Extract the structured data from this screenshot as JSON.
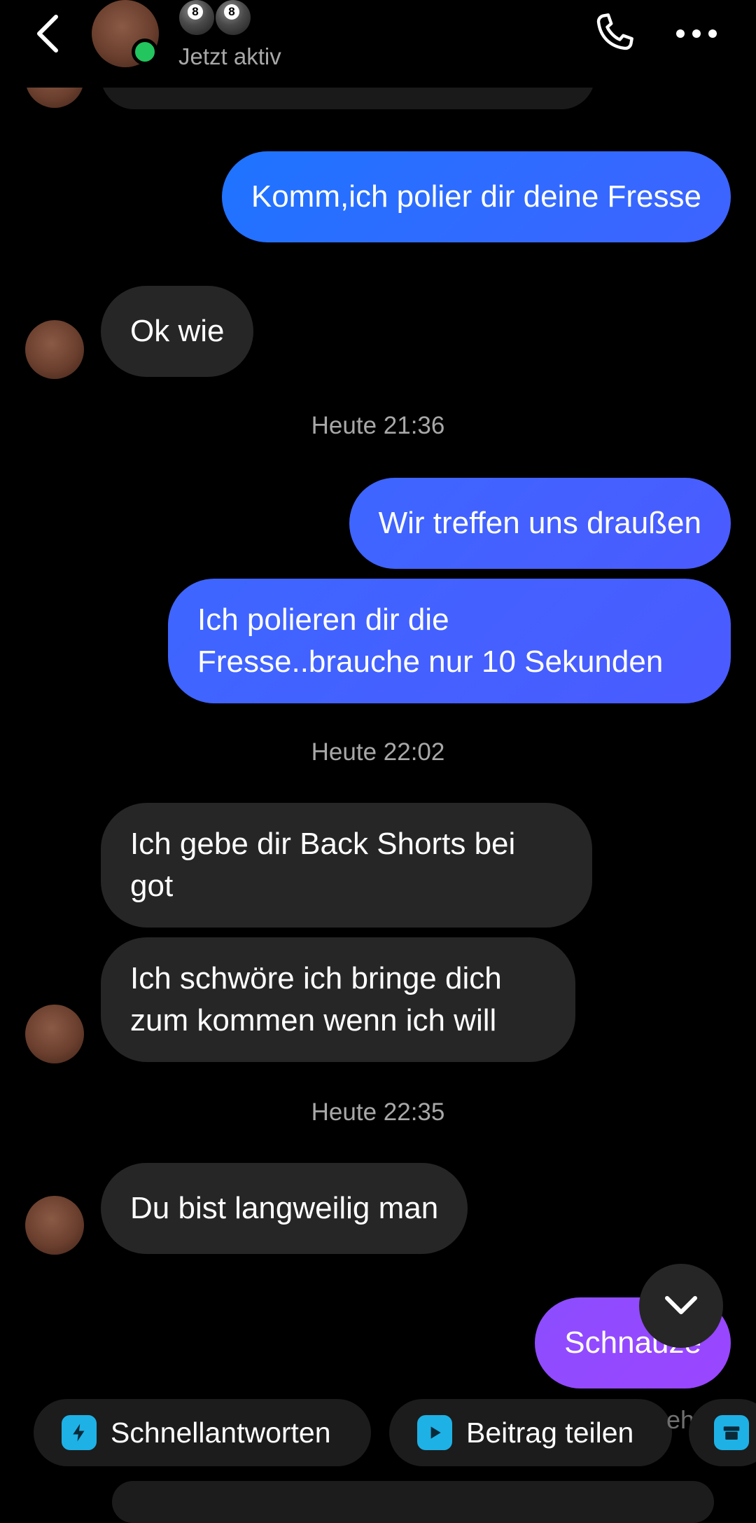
{
  "header": {
    "status": "Jetzt aktiv",
    "name_emoji_icons": [
      "8-ball-icon",
      "8-ball-icon"
    ]
  },
  "messages": [
    {
      "id": "m1",
      "direction": "out",
      "text": "Komm,ich polier dir deine Fresse"
    },
    {
      "id": "m2",
      "direction": "in",
      "text": "Ok wie"
    },
    {
      "id": "t1",
      "type": "timestamp",
      "text": "Heute 21:36"
    },
    {
      "id": "m3",
      "direction": "out",
      "text": "Wir treffen uns draußen"
    },
    {
      "id": "m4",
      "direction": "out",
      "lines": [
        "Ich polieren dir die",
        "Fresse..brauche nur 10 Sekunden"
      ]
    },
    {
      "id": "t2",
      "type": "timestamp",
      "text": "Heute 22:02"
    },
    {
      "id": "m5",
      "direction": "in",
      "lines": [
        "Ich gebe dir Back Shorts bei",
        "got"
      ]
    },
    {
      "id": "m6",
      "direction": "in",
      "lines": [
        "Ich schwöre ich bringe dich",
        "zum kommen wenn ich will"
      ]
    },
    {
      "id": "t3",
      "type": "timestamp",
      "text": "Heute 22:35"
    },
    {
      "id": "m7",
      "direction": "in",
      "text": "Du bist langweilig man"
    },
    {
      "id": "m8",
      "direction": "out",
      "text": "Schnauze"
    }
  ],
  "quick_actions": [
    {
      "label": "Schnellantworten",
      "icon": "quick-reply-icon"
    },
    {
      "label": "Beitrag teilen",
      "icon": "share-post-icon"
    },
    {
      "label": "",
      "icon": "shop-icon"
    }
  ],
  "colors": {
    "background": "#000000",
    "incoming_bubble": "#262626",
    "outgoing_blue": "#1e74ff",
    "outgoing_indigo": "#4b5bff",
    "outgoing_purple": "#9b45ff",
    "online": "#22c55e",
    "chip_icon": "#1eb1e6",
    "muted_text": "#a8a8a8"
  }
}
